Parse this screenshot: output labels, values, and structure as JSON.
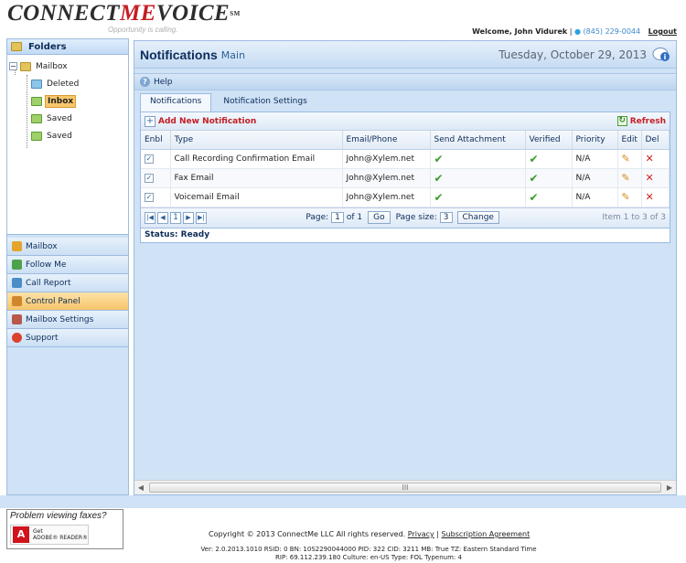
{
  "header": {
    "logo_connect": "CONNECT",
    "logo_me": "ME",
    "logo_voice": "VOICE",
    "logo_sm": "SM",
    "tagline": "Opportunity is calling.",
    "welcome": "Welcome, John Vidurek",
    "phone": "(845) 229-0044",
    "logout": "Logout"
  },
  "sidebar": {
    "folders_title": "Folders",
    "tree": [
      {
        "label": "Mailbox"
      },
      {
        "label": "Deleted"
      },
      {
        "label": "Inbox"
      },
      {
        "label": "Saved"
      },
      {
        "label": "Saved"
      }
    ],
    "nav": [
      {
        "label": "Mailbox",
        "color": "#e4a52c"
      },
      {
        "label": "Follow Me",
        "color": "#4ca24a"
      },
      {
        "label": "Call Report",
        "color": "#4b8cc9"
      },
      {
        "label": "Control Panel",
        "color": "#d1862b"
      },
      {
        "label": "Mailbox Settings",
        "color": "#b8574a"
      },
      {
        "label": "Support",
        "color": "#d9432e"
      }
    ]
  },
  "main": {
    "title": "Notifications",
    "subtitle": "Main",
    "date": "Tuesday, October 29, 2013",
    "help": "Help",
    "tabs": [
      "Notifications",
      "Notification Settings"
    ],
    "add_label": "Add New Notification",
    "refresh_label": "Refresh",
    "columns": [
      "Enbl",
      "Type",
      "Email/Phone",
      "Send Attachment",
      "Verified",
      "Priority",
      "Edit",
      "Del"
    ],
    "rows": [
      {
        "type": "Call Recording Confirmation Email",
        "contact": "John@Xylem.net",
        "priority": "N/A"
      },
      {
        "type": "Fax Email",
        "contact": "John@Xylem.net",
        "priority": "N/A"
      },
      {
        "type": "Voicemail Email",
        "contact": "John@Xylem.net",
        "priority": "N/A"
      }
    ],
    "pager": {
      "current_page": "1",
      "page_label": "Page:",
      "page_value": "1",
      "of_label": "of 1",
      "go": "Go",
      "size_label": "Page size:",
      "size_value": "3",
      "change": "Change",
      "info": "Item 1 to 3 of 3"
    },
    "status": "Status: Ready",
    "scroll_thumb": "III"
  },
  "footer": {
    "adobe_question": "Problem viewing faxes?",
    "adobe_get": "Get",
    "adobe_reader": "ADOBE® READER®",
    "copyright": "Copyright © 2013 ConnectMe LLC All rights reserved.",
    "privacy": "Privacy",
    "subscription": "Subscription Agreement",
    "version_line1": "Ver: 2.0.2013.1010  RSID: 0 BN: 10S2290044000 PID: 322 CID: 3211 MB: True  TZ: Eastern Standard Time",
    "version_line2": "RIP: 69.112.239.180 Culture: en-US Type: FOL Typenum: 4"
  }
}
